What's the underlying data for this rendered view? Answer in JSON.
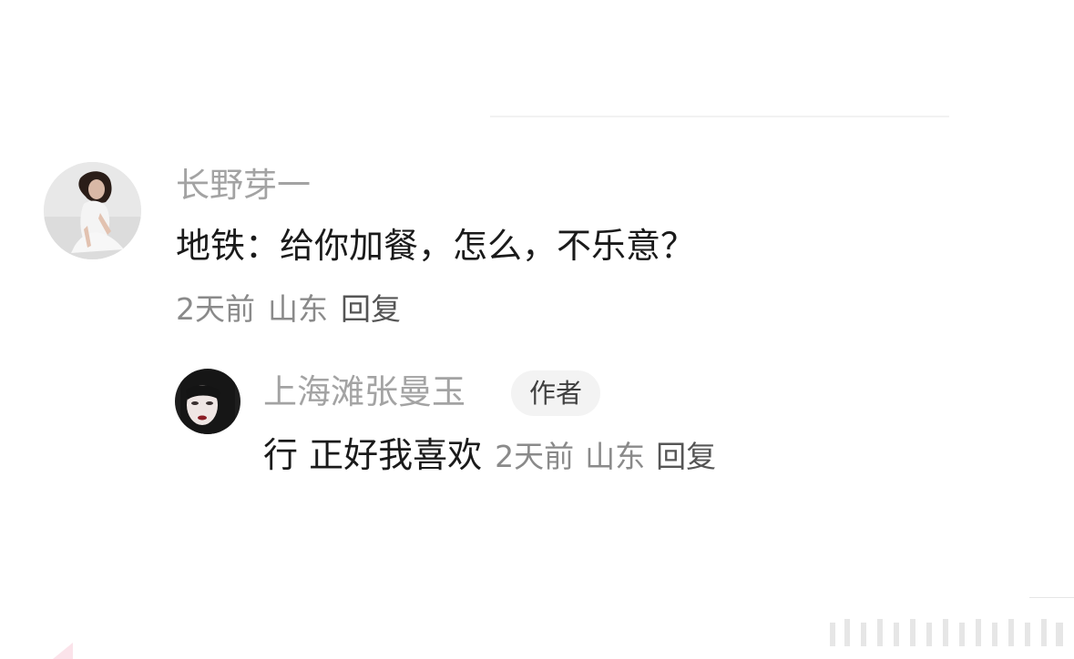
{
  "comment": {
    "username": "长野芽一",
    "text": "地铁：给你加餐，怎么，不乐意？",
    "time": "2天前",
    "location": "山东",
    "reply_label": "回复"
  },
  "reply": {
    "username": "上海滩张曼玉",
    "badge": "作者",
    "text": "行 正好我喜欢",
    "time": "2天前",
    "location": "山东",
    "reply_label": "回复"
  }
}
